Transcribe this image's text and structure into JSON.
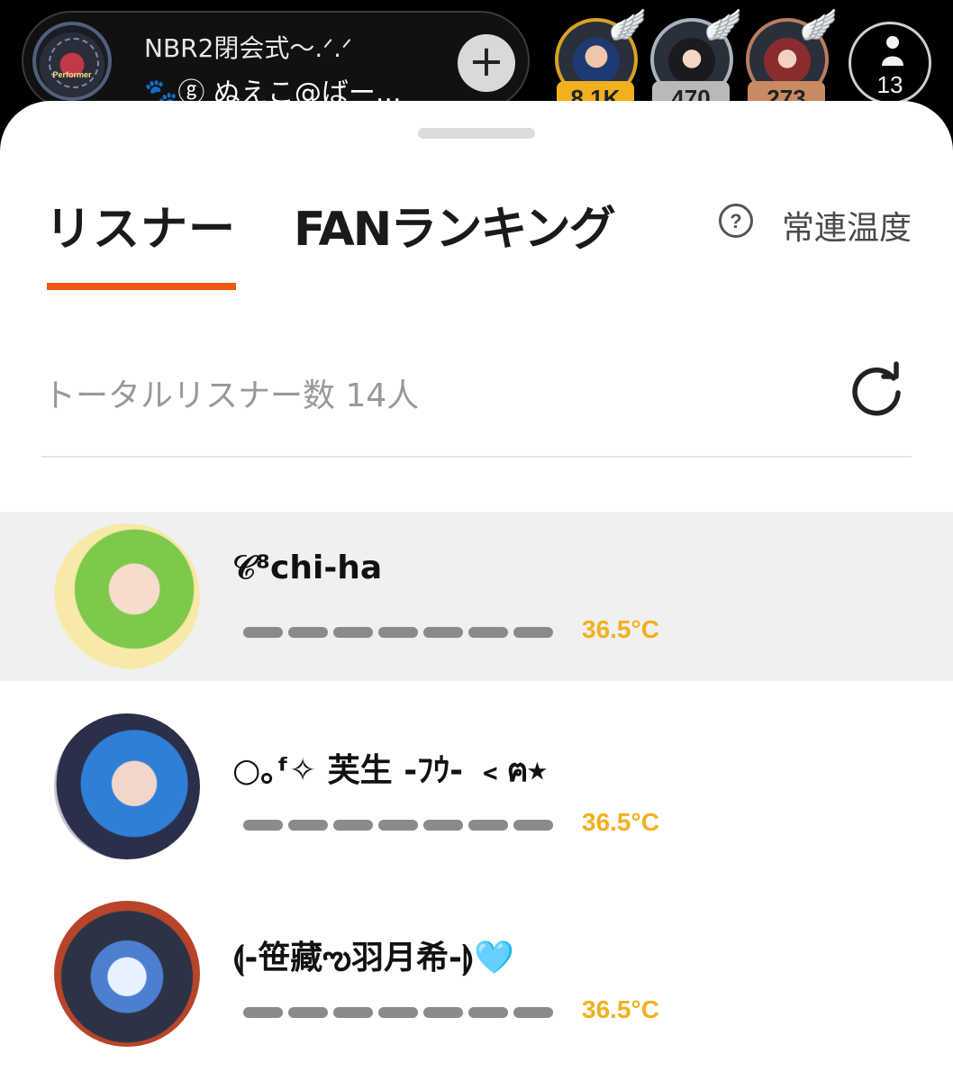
{
  "stream": {
    "title": "NBR2閉会式〜.ᐟ.ᐟ",
    "host_icon": "🐾",
    "host_name": "ⓖ ぬえこ@ばー...",
    "avatar_text": "Performer",
    "add_icon": "plus-icon",
    "top_fans": [
      {
        "score": "8.1K",
        "rank_color": "#f2b01e",
        "ring_color": "#d9a125"
      },
      {
        "score": "470",
        "rank_color": "#b9b9b9",
        "ring_color": "#a9b3bf"
      },
      {
        "score": "273",
        "rank_color": "#c98a63",
        "ring_color": "#b97e5e"
      }
    ],
    "viewer_count": "13"
  },
  "tabs": [
    {
      "label": "リスナー",
      "active": true
    },
    {
      "label": "FANランキング",
      "active": false
    }
  ],
  "regular_temperature_label": "常連温度",
  "help_icon": "?",
  "total_listeners_label": "トータルリスナー数 14人",
  "accent_color": "#f25a0f",
  "temperature_color": "#f2b01e",
  "listeners": [
    {
      "name": "𝒞⁸chi-ha",
      "temperature": "36.5°C",
      "highlighted": true
    },
    {
      "name": "○｡ᶠ✧ 芙生 -ﾌｳ- ﹤ฅ⭑",
      "temperature": "36.5°C",
      "highlighted": false
    },
    {
      "name": "⟬-笹藏ఌ羽月希-⟭🩵",
      "temperature": "36.5°C",
      "highlighted": false
    }
  ]
}
